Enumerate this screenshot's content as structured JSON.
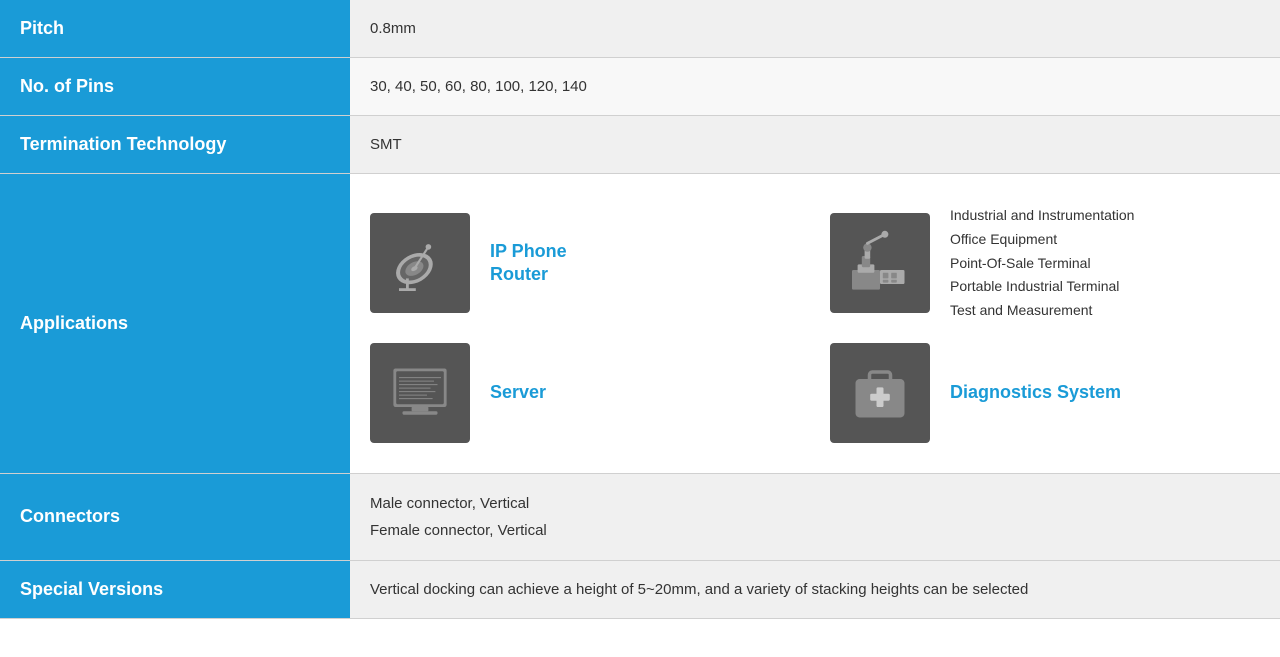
{
  "rows": {
    "pitch": {
      "label": "Pitch",
      "value": "0.8mm"
    },
    "nopins": {
      "label": "No. of Pins",
      "value": "30, 40, 50, 60, 80, 100, 120, 140"
    },
    "termination": {
      "label": "Termination Technology",
      "value": "SMT"
    },
    "applications": {
      "label": "Applications",
      "items": [
        {
          "icon": "satellite",
          "label": "IP Phone\nRouter"
        },
        {
          "icon": "industrial",
          "label": "Industrial and Instrumentation\nOffice Equipment\nPoint-Of-Sale Terminal\nPortable Industrial Terminal\nTest and Measurement"
        },
        {
          "icon": "server",
          "label": "Server"
        },
        {
          "icon": "diagnostics",
          "label": "Diagnostics System"
        }
      ]
    },
    "connectors": {
      "label": "Connectors",
      "line1": "Male connector, Vertical",
      "line2": "Female connector, Vertical"
    },
    "special": {
      "label": "Special Versions",
      "value": "Vertical docking can achieve a height of 5~20mm, and a variety of stacking heights can be selected"
    }
  }
}
